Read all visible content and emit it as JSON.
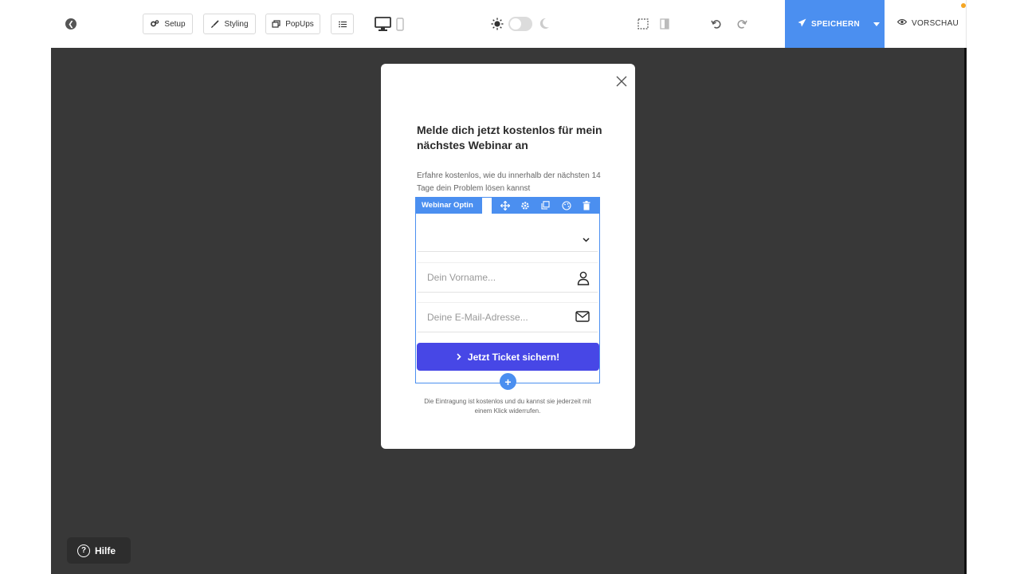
{
  "toolbar": {
    "setup_label": "Setup",
    "styling_label": "Styling",
    "popups_label": "PopUps",
    "save_label": "SPEICHERN",
    "preview_label": "VORSCHAU"
  },
  "popup": {
    "headline": "Melde dich jetzt kostenlos für mein nächstes Webinar an",
    "subtext": "Erfahre kostenlos, wie du innerhalb der nächsten 14 Tage dein Problem lösen kannst",
    "form": {
      "element_label": "Webinar Optin",
      "dropdown_value": "",
      "firstname_placeholder": "Dein Vorname...",
      "email_placeholder": "Deine E-Mail-Adresse...",
      "cta_label": "Jetzt Ticket sichern!",
      "add_symbol": "+"
    },
    "disclaimer": "Die Eintragung ist kostenlos und du kannst sie jederzeit mit einem Klick widerrufen."
  },
  "help": {
    "label": "Hilfe",
    "symbol": "?"
  },
  "colors": {
    "accent": "#4b8ff0",
    "cta": "#4747e6",
    "canvas": "#383838"
  }
}
